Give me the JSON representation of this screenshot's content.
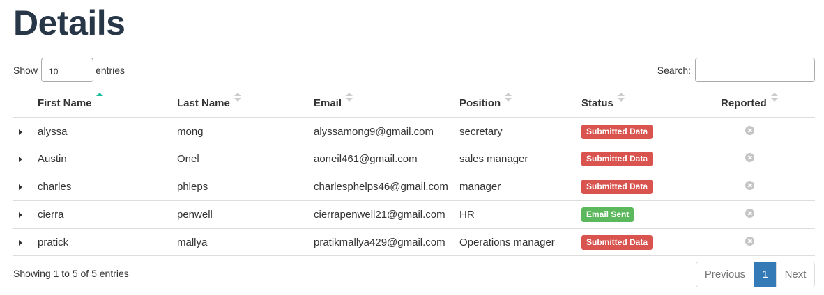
{
  "page": {
    "title": "Details"
  },
  "length": {
    "label_before": "Show",
    "value": "10",
    "label_after": "entries"
  },
  "search": {
    "label": "Search:",
    "value": "",
    "placeholder": ""
  },
  "table": {
    "columns": [
      {
        "label": "First Name",
        "sort": "asc"
      },
      {
        "label": "Last Name",
        "sort": "none"
      },
      {
        "label": "Email",
        "sort": "none"
      },
      {
        "label": "Position",
        "sort": "none"
      },
      {
        "label": "Status",
        "sort": "none"
      },
      {
        "label": "Reported",
        "sort": "none"
      }
    ],
    "rows": [
      {
        "first": "alyssa",
        "last": "mong",
        "email": "alyssamong9@gmail.com",
        "position": "secretary",
        "status": "Submitted Data",
        "status_color": "#d9534f",
        "reported_icon": "x-circle-icon"
      },
      {
        "first": "Austin",
        "last": "Onel",
        "email": "aoneil461@gmail.com",
        "position": "sales manager",
        "status": "Submitted Data",
        "status_color": "#d9534f",
        "reported_icon": "x-circle-icon"
      },
      {
        "first": "charles",
        "last": "phleps",
        "email": "charlesphelps46@gmail.com",
        "position": "manager",
        "status": "Submitted Data",
        "status_color": "#d9534f",
        "reported_icon": "x-circle-icon"
      },
      {
        "first": "cierra",
        "last": "penwell",
        "email": "cierrapenwell21@gmail.com",
        "position": "HR",
        "status": "Email Sent",
        "status_color": "#5cb85c",
        "reported_icon": "x-circle-icon"
      },
      {
        "first": "pratick",
        "last": "mallya",
        "email": "pratikmallya429@gmail.com",
        "position": "Operations manager",
        "status": "Submitted Data",
        "status_color": "#d9534f",
        "reported_icon": "x-circle-icon"
      }
    ]
  },
  "footer": {
    "info": "Showing 1 to 5 of 5 entries"
  },
  "pagination": {
    "previous": "Previous",
    "current": "1",
    "next": "Next"
  },
  "colors": {
    "title": "#283747",
    "sort_active": "#1abc9c",
    "page_active": "#337ab7"
  }
}
